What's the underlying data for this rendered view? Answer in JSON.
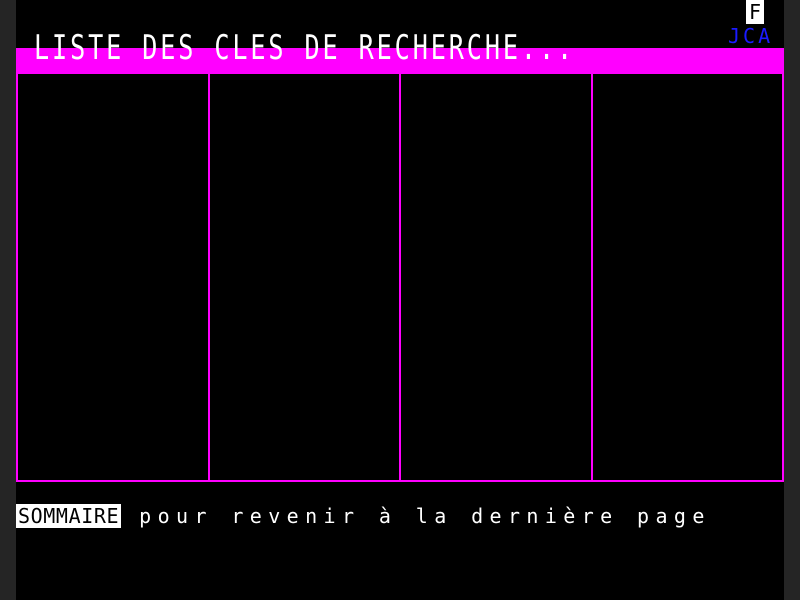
{
  "header": {
    "title": "LISTE DES CLES DE RECHERCHE...",
    "badge_f": "F",
    "badge_jca": "JCA"
  },
  "results": {
    "columns": [
      "",
      "",
      "",
      ""
    ]
  },
  "footer": {
    "key_label": "SOMMAIRE",
    "instruction": "pour revenir à la dernière page"
  },
  "colors": {
    "background": "#000000",
    "accent": "#ff00ff",
    "text": "#ffffff",
    "badge_blue": "#1a1aff",
    "side_strip": "#252525"
  }
}
